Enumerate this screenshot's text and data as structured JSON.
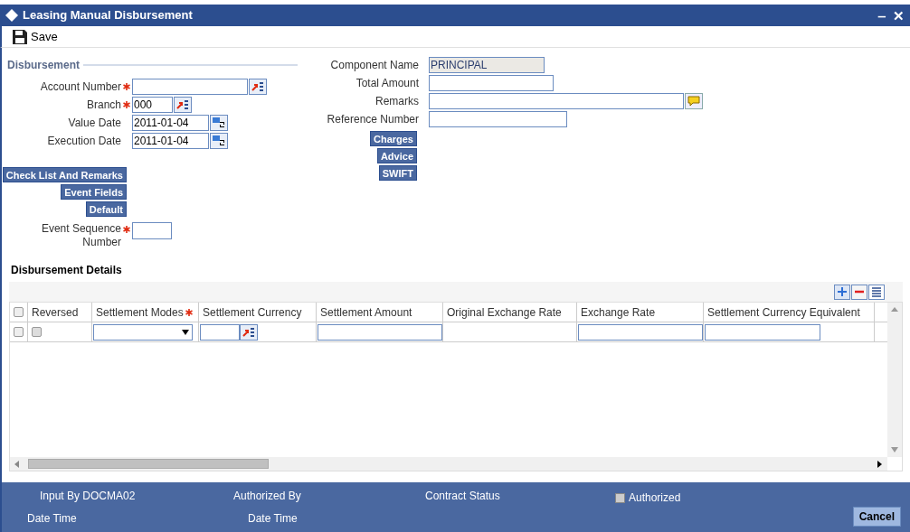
{
  "window": {
    "title": "Leasing Manual Disbursement",
    "controls": [
      "‒",
      "✕"
    ]
  },
  "toolbar": {
    "save": "Save"
  },
  "disbursement": {
    "title": "Disbursement",
    "left_fields": [
      {
        "label": "Account Number",
        "required": true,
        "kind": "lookup"
      },
      {
        "label": "Branch",
        "required": true,
        "value": "000",
        "kind": "lookup"
      },
      {
        "label": "Value Date",
        "required": false,
        "value": "2011-01-04",
        "kind": "calendar"
      },
      {
        "label": "Execution Date",
        "required": false,
        "value": "2011-01-04",
        "kind": "calendar"
      }
    ],
    "left_buttons": [
      "Check List And Remarks",
      "Event Fields",
      "Default"
    ],
    "sequence": {
      "label_lines": [
        "Event Sequence",
        "Number"
      ],
      "required": true
    },
    "right_fields": [
      {
        "label": "Component Name",
        "value": "PRINCIPAL",
        "kind": "readonly"
      },
      {
        "label": "Total Amount",
        "kind": "text"
      },
      {
        "label": "Remarks",
        "kind": "remarks"
      },
      {
        "label": "Reference Number",
        "kind": "text"
      }
    ],
    "right_buttons": [
      "Charges",
      "Advice",
      "SWIFT"
    ]
  },
  "details": {
    "title": "Disbursement Details",
    "columns": [
      {
        "label": "Reversed",
        "required": false
      },
      {
        "label": "Settlement Modes",
        "required": true
      },
      {
        "label": "Settlement Currency",
        "required": false
      },
      {
        "label": "Settlement Amount",
        "required": false
      },
      {
        "label": "Original Exchange Rate",
        "required": false
      },
      {
        "label": "Exchange Rate",
        "required": false
      },
      {
        "label": "Settlement Currency Equivalent",
        "required": false
      }
    ],
    "header_checked": false,
    "rows": [
      {
        "checked": false,
        "cells": [
          {
            "kind": "checkbox",
            "checked": false
          },
          {
            "kind": "select"
          },
          {
            "kind": "lookup"
          },
          {
            "kind": "input"
          },
          {
            "kind": "empty"
          },
          {
            "kind": "input"
          },
          {
            "kind": "input"
          }
        ]
      }
    ]
  },
  "footer": {
    "input_by": "Input By DOCMA02",
    "authorized_by": "Authorized By",
    "contract_status": "Contract Status",
    "authorized": {
      "label": "Authorized",
      "checked": false
    },
    "date_time_1": "Date Time",
    "date_time_2": "Date Time",
    "cancel": "Cancel"
  }
}
